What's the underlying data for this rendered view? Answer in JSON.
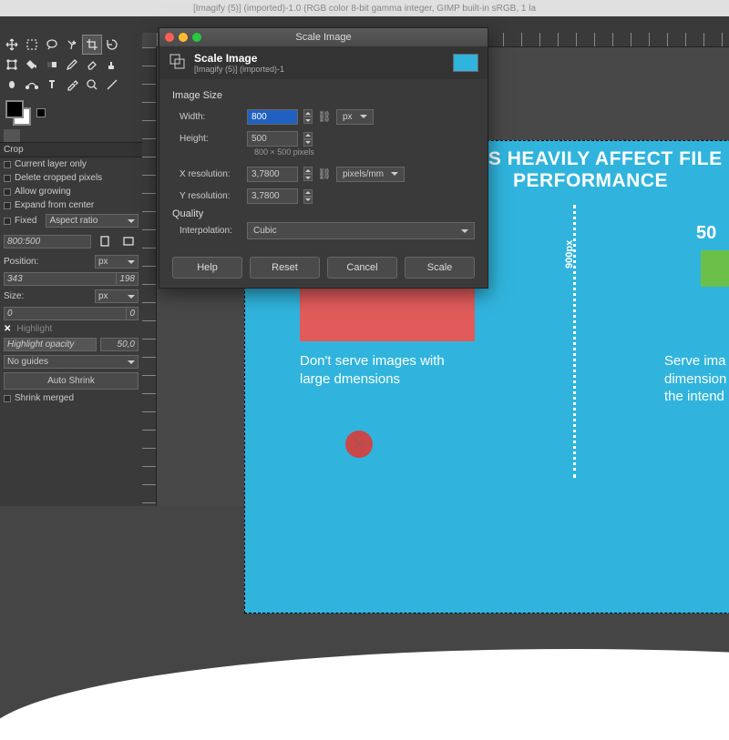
{
  "titlebar": "[Imagify (5)] (imported)-1.0 (RGB color 8-bit gamma integer, GIMP built-in sRGB, 1 la",
  "toolbox": {
    "crop_title": "Crop",
    "opt_current_layer": "Current layer only",
    "opt_delete_cropped": "Delete cropped pixels",
    "opt_allow_grow": "Allow growing",
    "opt_expand_center": "Expand from center",
    "fixed": "Fixed",
    "aspect_ratio": "Aspect ratio",
    "aspect_value": "800:500",
    "position": "Position:",
    "px": "px",
    "pos_x": "343",
    "pos_y": "198",
    "size": "Size:",
    "size_w": "0",
    "size_h": "0",
    "highlight": "Highlight",
    "highlight_opacity": "Highlight opacity",
    "hl_value": "50,0",
    "no_guides": "No guides",
    "auto_shrink": "Auto Shrink",
    "shrink_merged": "Shrink merged"
  },
  "canvas": {
    "heading_l1": "ONS HEAVILY AFFECT FILE",
    "heading_l2": "PERFORMANCE",
    "caption1_l1": "Don't serve images with",
    "caption1_l2": "large dmensions",
    "caption2_l1": "Serve ima",
    "caption2_l2": "dimension",
    "caption2_l3": "the intend",
    "vlabel": "900px",
    "num500": "50"
  },
  "dialog": {
    "title": "Scale Image",
    "header_title": "Scale Image",
    "header_sub": "[Imagify (5)] (imported)-1",
    "image_size": "Image Size",
    "width": "Width:",
    "height": "Height:",
    "w_val": "800",
    "h_val": "500",
    "px": "px",
    "note": "800 × 500 pixels",
    "xres": "X resolution:",
    "yres": "Y resolution:",
    "xres_val": "3,7800",
    "yres_val": "3,7800",
    "res_unit": "pixels/mm",
    "quality": "Quality",
    "interp": "Interpolation:",
    "interp_val": "Cubic",
    "help": "Help",
    "reset": "Reset",
    "cancel": "Cancel",
    "scale": "Scale"
  }
}
